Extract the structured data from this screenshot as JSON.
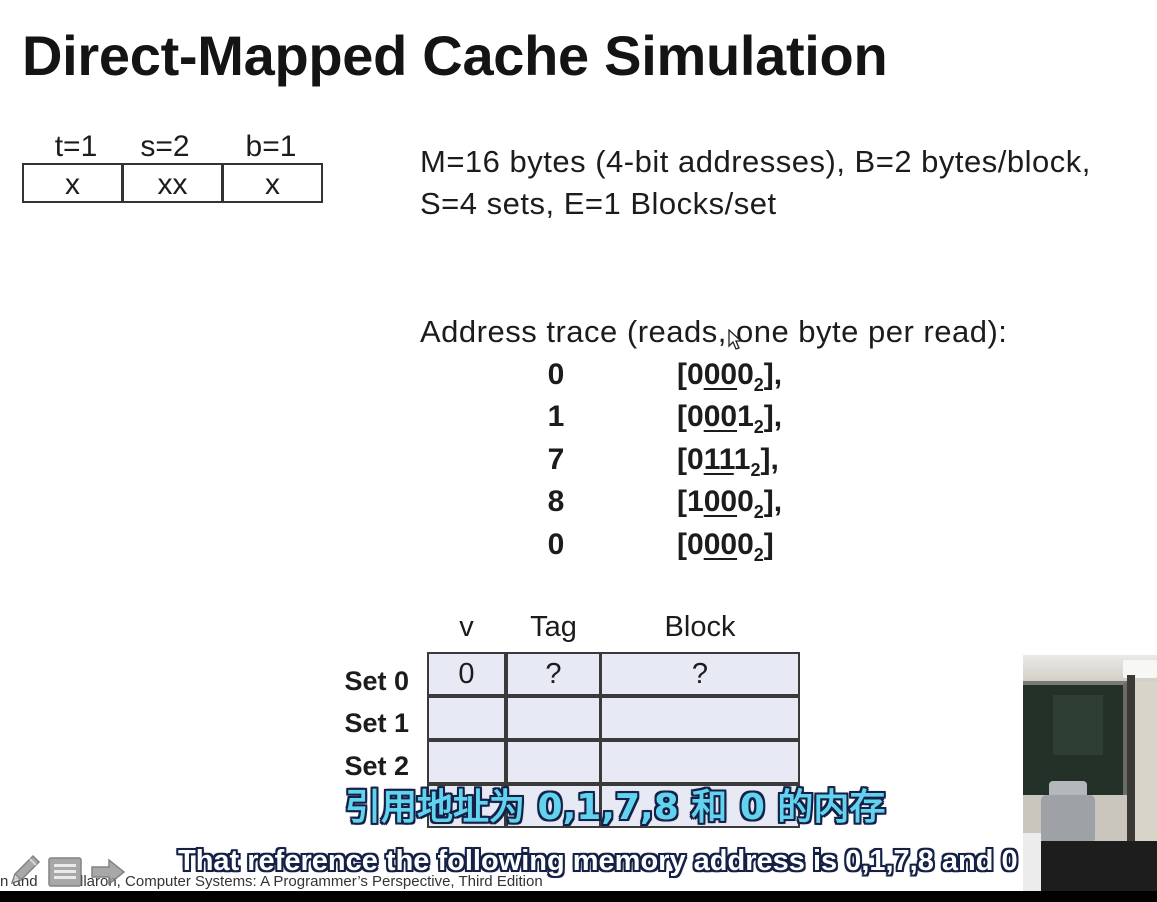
{
  "slide": {
    "title": "Direct-Mapped Cache Simulation",
    "address_fields": [
      {
        "label": "t=1",
        "value": "x"
      },
      {
        "label": "s=2",
        "value": "xx"
      },
      {
        "label": "b=1",
        "value": "x"
      }
    ],
    "params": {
      "line1": "M=16 bytes (4-bit addresses), B=2 bytes/block,",
      "line2": "S=4 sets, E=1 Blocks/set"
    },
    "trace": {
      "heading": "Address trace (reads, one byte per read):",
      "rows": [
        {
          "address": "0",
          "open": "[0",
          "set_bits": "00",
          "last": "0",
          "base": "2",
          "end": "],"
        },
        {
          "address": "1",
          "open": "[0",
          "set_bits": "00",
          "last": "1",
          "base": "2",
          "end": "],"
        },
        {
          "address": "7",
          "open": "[0",
          "set_bits": "11",
          "last": "1",
          "base": "2",
          "end": "],"
        },
        {
          "address": "8",
          "open": "[1",
          "set_bits": "00",
          "last": "0",
          "base": "2",
          "end": "],"
        },
        {
          "address": "0",
          "open": "[0",
          "set_bits": "00",
          "last": "0",
          "base": "2",
          "end": "]"
        }
      ]
    },
    "cache": {
      "headers": {
        "valid": "v",
        "tag": "Tag",
        "block": "Block"
      },
      "sets": [
        {
          "label": "Set 0",
          "v": "0",
          "tag": "?",
          "block": "?"
        },
        {
          "label": "Set 1"
        },
        {
          "label": "Set 2"
        }
      ]
    },
    "citation": {
      "part1": "n and",
      "part2": "llaron, Computer Systems: A Programmer’s Perspective, Third Edition"
    }
  },
  "subtitles": {
    "zh": "引用地址为 0,1,7,8 和 0 的内存",
    "en": "That reference the following memory address is 0,1,7,8 and 0"
  },
  "player_controls": [
    {
      "icon": "pen-icon"
    },
    {
      "icon": "slides-menu-icon"
    },
    {
      "icon": "next-slide-arrow-icon"
    }
  ],
  "colors": {
    "title": "#141414",
    "text": "#1c1c1c",
    "table_fill": "#e7eaf4",
    "table_border": "#3a3a3a",
    "subtitle_zh": "#62d3ee",
    "subtitle_outline": "#142046",
    "subtitle_en": "#ffffff",
    "bottom_bar": "#000000"
  }
}
